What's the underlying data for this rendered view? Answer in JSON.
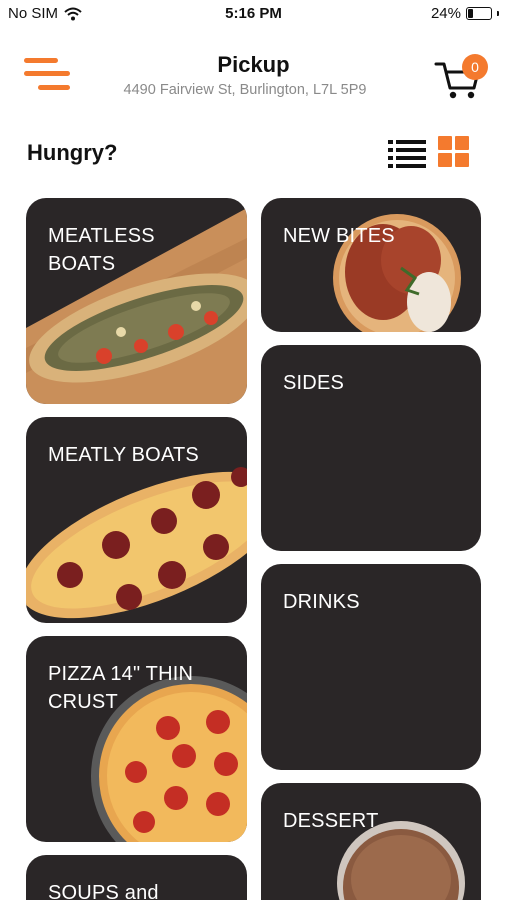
{
  "status_bar": {
    "carrier": "No SIM",
    "time": "5:16 PM",
    "battery": "24%",
    "battery_level": 0.24
  },
  "header": {
    "title": "Pickup",
    "address": "4490 Fairview St, Burlington, L7L 5P9",
    "cart_count": "0"
  },
  "section": {
    "title": "Hungry?"
  },
  "categories": {
    "meatless_boats": "MEATLESS\nBOATS",
    "meatly_boats": "MEATLY BOATS",
    "pizza": "PIZZA 14\" THIN\nCRUST",
    "soups": "SOUPS and",
    "new_bites": "NEW BITES",
    "sides": "SIDES",
    "drinks": "DRINKS",
    "dessert": "DESSERT"
  },
  "colors": {
    "accent": "#f47a2e",
    "tile_bg": "#2a2627"
  },
  "icons": {
    "menu": "menu-icon",
    "cart": "cart-icon",
    "list_view": "list-view-icon",
    "grid_view": "grid-view-icon",
    "wifi": "wifi-icon",
    "battery": "battery-icon"
  }
}
